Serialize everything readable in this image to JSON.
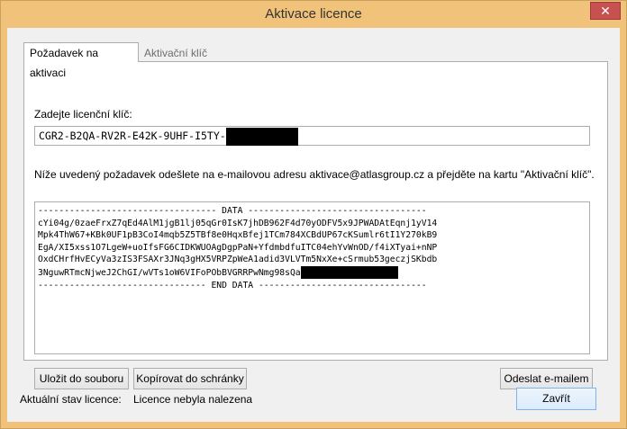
{
  "window": {
    "title": "Aktivace licence",
    "close_glyph": "✕"
  },
  "tabs": [
    {
      "label": "Požadavek na aktivaci",
      "active": true
    },
    {
      "label": "Aktivační klíč",
      "active": false
    }
  ],
  "request_tab": {
    "key_label": "Zadejte licenční klíč:",
    "key_value": "CGR2-B2QA-RV2R-E42K-9UHF-I5TY-",
    "instructions": "Níže uvedený požadavek odešlete na e-mailovou adresu aktivace@atlasgroup.cz a přejděte na kartu \"Aktivační klíč\".",
    "data_lines": [
      "---------------------------------- DATA ----------------------------------",
      "cYi04g/0zaeFrxZ7qEd4AlM1jgB1lj05qGr0IsK7jhDB962F4d70yODFV5x9JPWADAtEqnj1yV14",
      "Mpk4ThW67+KBk0UF1pB3CoI4mqb5Z5TBf8e0HqxBfej1TCm784XCBdUP67cKSumlr6tI1Y270kB9",
      "EgA/XI5xss1O7LgeW+uoIfsFG6CIDKWUOAgDgpPaN+YfdmbdfuITC04ehYvWnOD/f4iXTyai+nNP",
      "OxdCHrfHvECyVa3zIS3FSAXr3JNq3gHX5VRPZpWeA1adid3VLVTm5NxXe+cSrmub53geczjSKbdb",
      "3NguwRTmcNjweJ2ChGI/wVTs1oW6VIFoPObBVGRRPwNmg98sQa",
      "-------------------------------- END DATA --------------------------------"
    ],
    "save_button": "Uložit do souboru",
    "copy_button": "Kopírovat do schránky",
    "email_button": "Odeslat e-mailem"
  },
  "status": {
    "label": "Aktuální stav licence:",
    "value": "Licence nebyla nalezena"
  },
  "close_button": "Zavřít",
  "colors": {
    "titlebar": "#f0c27a",
    "close": "#c75050",
    "panel": "#ffffff"
  }
}
